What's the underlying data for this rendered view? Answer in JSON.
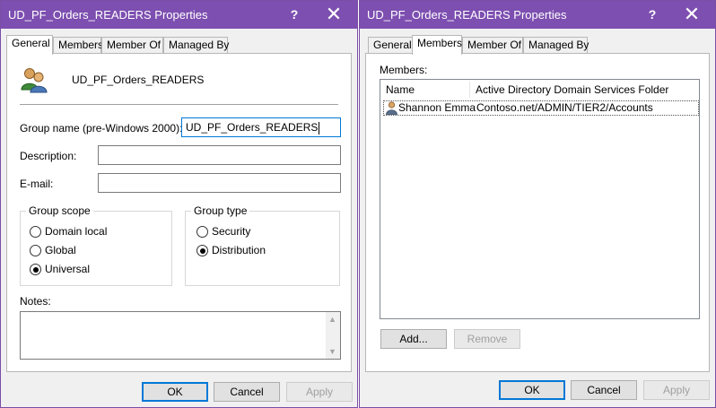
{
  "left_dialog": {
    "title": "UD_PF_Orders_READERS Properties",
    "title_buttons": {
      "help": "?",
      "close": "✕"
    },
    "tabs": [
      "General",
      "Members",
      "Member Of",
      "Managed By"
    ],
    "active_tab": "General",
    "group_display_name": "UD_PF_Orders_READERS",
    "group_icon": "users-group-icon",
    "fields": {
      "group_name_label": "Group name (pre-Windows 2000):",
      "group_name_value": "UD_PF_Orders_READERS",
      "description_label": "Description:",
      "description_value": "",
      "email_label": "E-mail:",
      "email_value": ""
    },
    "group_scope": {
      "title": "Group scope",
      "options": [
        "Domain local",
        "Global",
        "Universal"
      ],
      "selected": "Universal"
    },
    "group_type": {
      "title": "Group type",
      "options": [
        "Security",
        "Distribution"
      ],
      "selected": "Distribution"
    },
    "notes_label": "Notes:",
    "notes_value": "",
    "buttons": {
      "ok": "OK",
      "cancel": "Cancel",
      "apply": "Apply"
    }
  },
  "right_dialog": {
    "title": "UD_PF_Orders_READERS Properties",
    "title_buttons": {
      "help": "?",
      "close": "✕"
    },
    "tabs": [
      "General",
      "Members",
      "Member Of",
      "Managed By"
    ],
    "active_tab": "Members",
    "members_label": "Members:",
    "columns": [
      "Name",
      "Active Directory Domain Services Folder"
    ],
    "rows": [
      {
        "name": "Shannon Emma",
        "folder": "Contoso.net/ADMIN/TIER2/Accounts",
        "icon": "user-icon"
      }
    ],
    "add_button": "Add...",
    "remove_button": "Remove",
    "buttons": {
      "ok": "OK",
      "cancel": "Cancel",
      "apply": "Apply"
    }
  },
  "colors": {
    "titlebar": "#7d4fb0",
    "focus_border": "#0078d7",
    "window_bg": "#f0f0f0"
  }
}
